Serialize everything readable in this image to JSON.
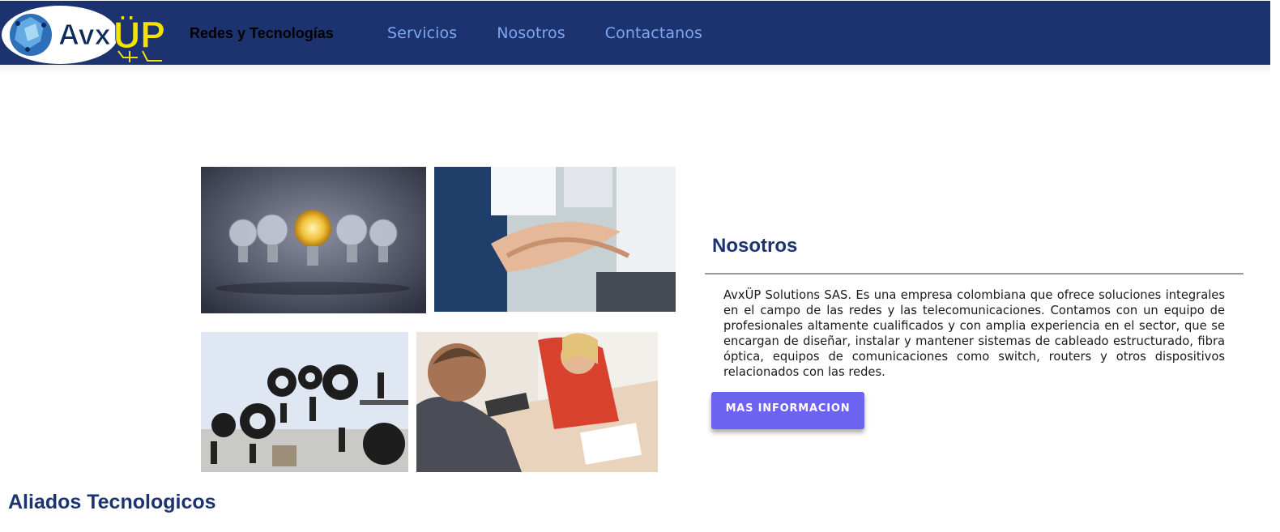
{
  "header": {
    "logo_text": "AvxÜP",
    "brand_name": "Redes y Tecnologías",
    "nav": [
      {
        "label": "Servicios"
      },
      {
        "label": "Nosotros"
      },
      {
        "label": "Contactanos"
      }
    ]
  },
  "about": {
    "title": "Nosotros",
    "description": "AvxÜP Solutions SAS. Es una empresa colombiana que ofrece soluciones integrales en el campo de las redes y las telecomunicaciones. Contamos con un equipo de profesionales altamente cualificados y con amplia experiencia en el sector, que se encargan de diseñar, instalar y mantener sistemas de cableado estructurado, fibra óptica, equipos de comunicaciones como switch, routers y otros dispositivos relacionados con las redes.",
    "button_label": "MAS INFORMACION"
  },
  "allies": {
    "title": "Aliados Tecnologicos"
  },
  "colors": {
    "header_bg": "#1c3370",
    "nav_link": "#7ea7ef",
    "heading": "#1c3370",
    "button_bg": "#6c63f0",
    "logo_yellow": "#f2e200"
  },
  "images": [
    {
      "icon": "lightbulbs-image"
    },
    {
      "icon": "team-hands-image"
    },
    {
      "icon": "gears-teamwork-image"
    },
    {
      "icon": "business-handshake-image"
    }
  ]
}
